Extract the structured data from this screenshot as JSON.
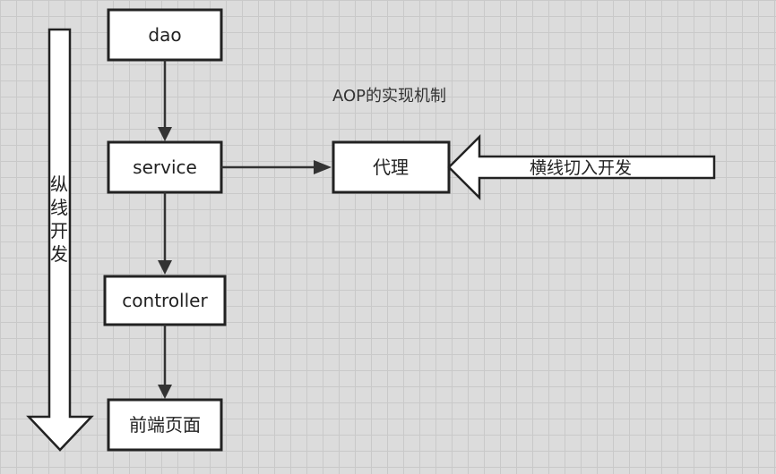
{
  "diagram": {
    "title": "AOP的实现机制",
    "nodes": {
      "dao": "dao",
      "service": "service",
      "proxy": "代理",
      "controller": "controller",
      "frontend": "前端页面"
    },
    "vertical_label": [
      "纵",
      "线",
      "开",
      "发"
    ],
    "horizontal_label": "横线切入开发",
    "edges": [
      {
        "from": "dao",
        "to": "service"
      },
      {
        "from": "service",
        "to": "controller"
      },
      {
        "from": "controller",
        "to": "frontend"
      },
      {
        "from": "service",
        "to": "proxy"
      }
    ]
  }
}
